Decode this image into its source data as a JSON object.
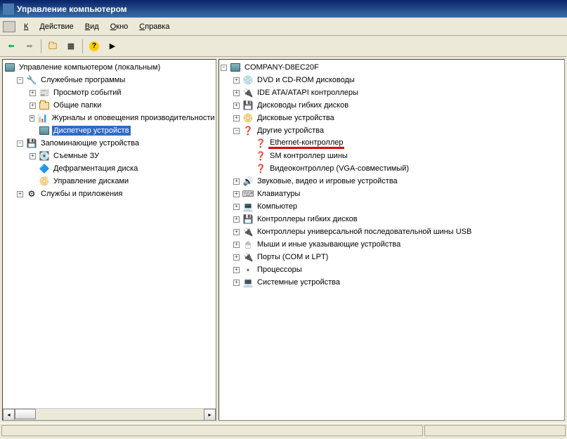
{
  "window": {
    "title": "Управление компьютером"
  },
  "menu": {
    "console": "Консоль",
    "action": "Действие",
    "view": "Вид",
    "window": "Окно",
    "help": "Справка"
  },
  "toolbar": {
    "back": "←",
    "forward": "→",
    "up": "folder-up",
    "views": "views",
    "help": "?",
    "props": "props"
  },
  "left_tree": {
    "root": "Управление компьютером (локальным)",
    "system_tools": "Служебные программы",
    "event_viewer": "Просмотр событий",
    "shared_folders": "Общие папки",
    "logs_alerts": "Журналы и оповещения производительности",
    "device_manager": "Диспетчер устройств",
    "storage": "Запоминающие устройства",
    "removable": "Съемные ЗУ",
    "defrag": "Дефрагментация диска",
    "disk_mgmt": "Управление дисками",
    "services_apps": "Службы и приложения"
  },
  "right_tree": {
    "root": "COMPANY-D8EC20F",
    "dvd_cd": "DVD и CD-ROM дисководы",
    "ide": "IDE ATA/ATAPI контроллеры",
    "floppy_drives": "Дисководы гибких дисков",
    "disk_drives": "Дисковые устройства",
    "other_devices": "Другие устройства",
    "ethernet": "Ethernet-контроллер",
    "sm_bus": "SM контроллер шины",
    "video": "Видеоконтроллер (VGA-совместимый)",
    "sound": "Звуковые, видео и игровые устройства",
    "keyboard": "Клавиатуры",
    "computer": "Компьютер",
    "floppy_ctrl": "Контроллеры гибких дисков",
    "usb": "Контроллеры универсальной последовательной шины USB",
    "mice": "Мыши и иные указывающие устройства",
    "ports": "Порты (COM и LPT)",
    "processors": "Процессоры",
    "system_devices": "Системные устройства"
  }
}
